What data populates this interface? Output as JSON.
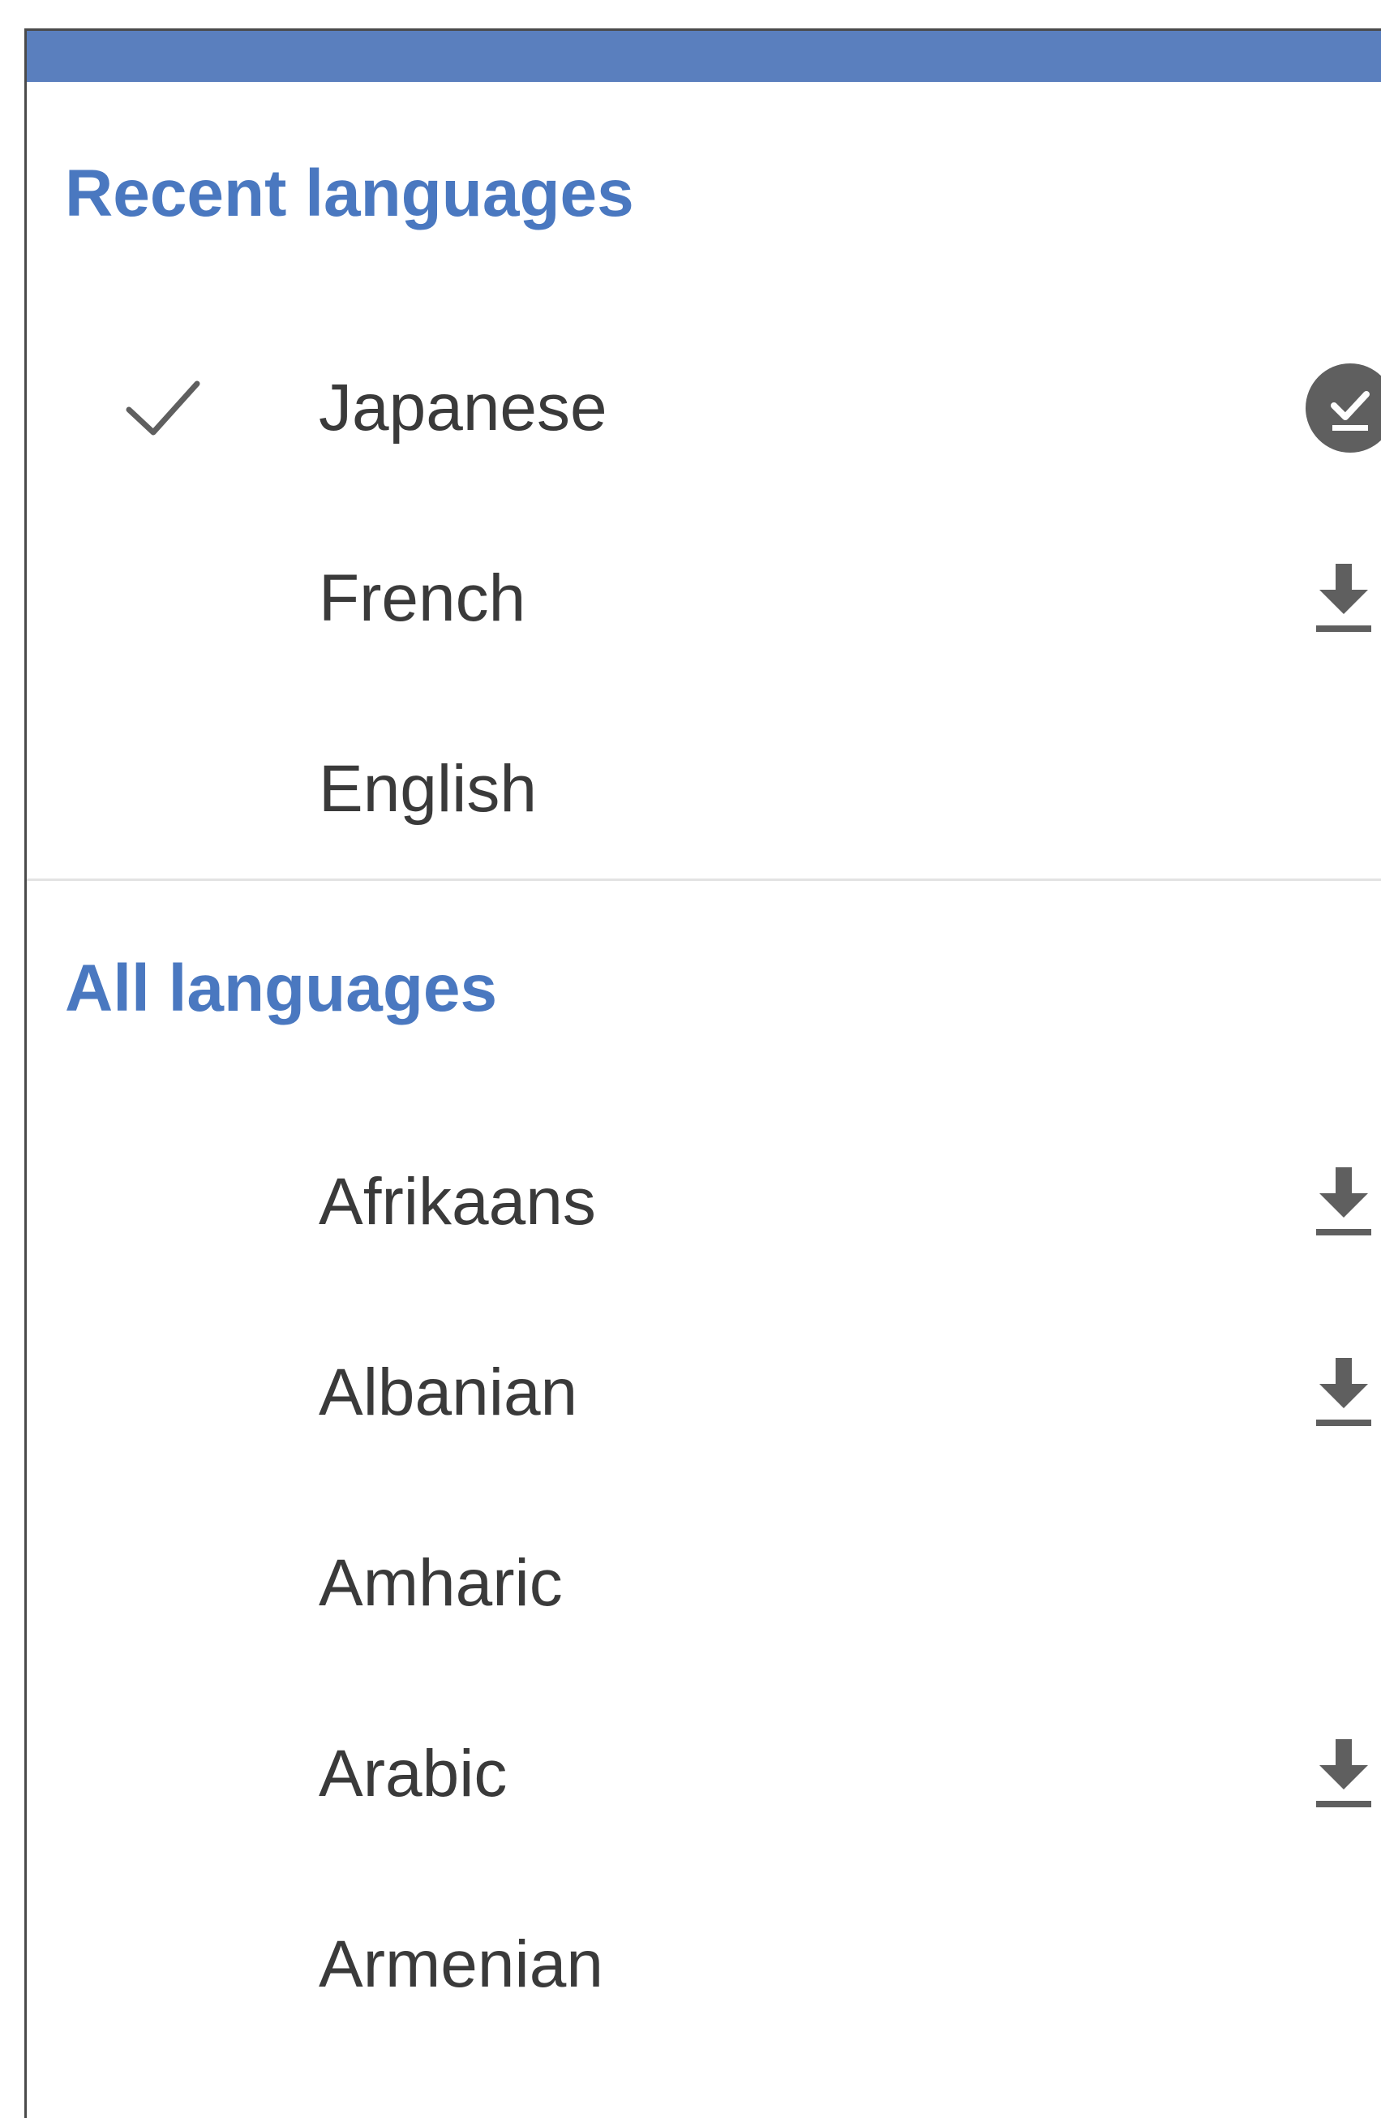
{
  "recent_section": {
    "title": "Recent languages",
    "items": [
      {
        "label": "Japanese",
        "selected": true,
        "download_state": "downloaded"
      },
      {
        "label": "French",
        "selected": false,
        "download_state": "available"
      },
      {
        "label": "English",
        "selected": false,
        "download_state": "none"
      }
    ]
  },
  "all_section": {
    "title": "All languages",
    "items": [
      {
        "label": "Afrikaans",
        "download_state": "available"
      },
      {
        "label": "Albanian",
        "download_state": "available"
      },
      {
        "label": "Amharic",
        "download_state": "none"
      },
      {
        "label": "Arabic",
        "download_state": "available"
      },
      {
        "label": "Armenian",
        "download_state": "none"
      }
    ]
  },
  "icons": {
    "selected": "check-icon",
    "downloaded": "downloaded-check-icon",
    "available": "download-icon"
  },
  "colors": {
    "top_bar": "#5a7fbe",
    "section_header": "#4a78c0",
    "item_text": "#3a3a3a",
    "icon": "#5f5f5f",
    "divider": "#e3e3e3"
  }
}
